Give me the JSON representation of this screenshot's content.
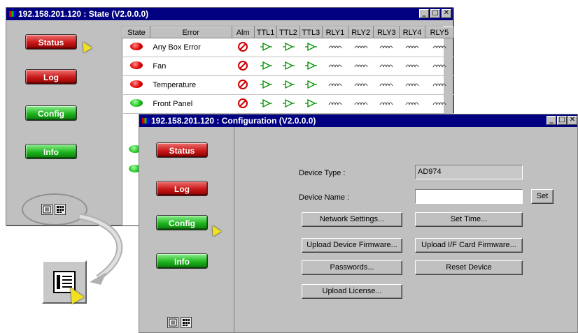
{
  "state_window": {
    "title": "192.158.201.120 : State (V2.0.0.0)",
    "controls": [
      "_",
      "□",
      "✕"
    ],
    "nav": {
      "status": "Status",
      "log": "Log",
      "config": "Config",
      "info": "Info"
    },
    "columns": [
      "State",
      "Error",
      "Alm",
      "TTL1",
      "TTL2",
      "TTL3",
      "RLY1",
      "RLY2",
      "RLY3",
      "RLY4",
      "RLY5"
    ],
    "rows": [
      {
        "state": "red",
        "error": "Any Box Error"
      },
      {
        "state": "red",
        "error": "Fan"
      },
      {
        "state": "red",
        "error": "Temperature"
      },
      {
        "state": "green",
        "error": "Front Panel"
      }
    ],
    "colors": {
      "titlebar": "#000080",
      "led_red": "#e00000",
      "led_green": "#20c020",
      "alarm": "#cc0000",
      "ttl": "#009000"
    }
  },
  "config_window": {
    "title": "192.158.201.120 : Configuration (V2.0.0.0)",
    "controls": [
      "_",
      "□",
      "✕"
    ],
    "nav": {
      "status": "Status",
      "log": "Log",
      "config": "Config",
      "info": "Info"
    },
    "device_type_label": "Device Type :",
    "device_type_value": "AD974",
    "device_name_label": "Device Name :",
    "device_name_value": "",
    "set_label": "Set",
    "buttons": {
      "network_settings": "Network Settings...",
      "set_time": "Set Time...",
      "upload_device_firmware": "Upload Device Firmware...",
      "upload_card_firmware": "Upload I/F Card Firmware...",
      "passwords": "Passwords...",
      "reset_device": "Reset Device",
      "upload_license": "Upload License..."
    }
  },
  "icons": {
    "list_view": "list-view-icon",
    "grid_view": "grid-view-icon",
    "pointer": "mouse-pointer-icon"
  }
}
